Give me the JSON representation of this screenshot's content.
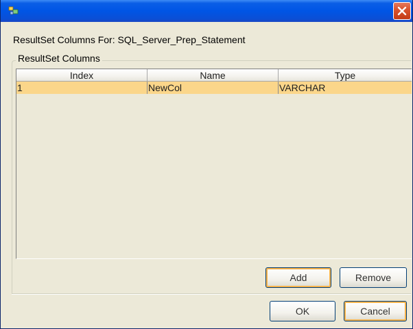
{
  "dialog": {
    "header_label": "ResultSet Columns For:  SQL_Server_Prep_Statement",
    "group_title": "ResultSet Columns"
  },
  "table": {
    "columns": [
      "Index",
      "Name",
      "Type"
    ],
    "rows": [
      {
        "index": "1",
        "name": "NewCol",
        "type": "VARCHAR"
      }
    ],
    "selected_row_color": "#fbd68a"
  },
  "buttons": {
    "add_label": "Add",
    "remove_label": "Remove",
    "ok_label": "OK",
    "cancel_label": "Cancel"
  },
  "titlebar": {
    "color": "#0055e5",
    "app_icon": "app-icon",
    "close_icon": "close-icon",
    "close_color": "#d9542f"
  }
}
